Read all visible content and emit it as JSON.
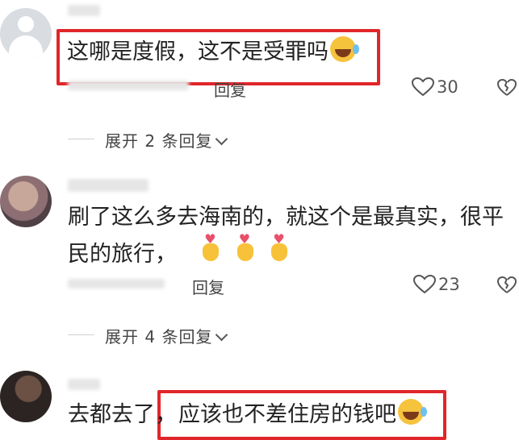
{
  "comments": [
    {
      "text": "这哪是度假，这不是受罪吗",
      "reply_label": "回复",
      "like_count": "30",
      "expand_label": "展开 2 条回复"
    },
    {
      "text_line1": "刷了这么多去海南的，就这个是最真实，很平",
      "text_line2": "民的旅行，",
      "reply_label": "回复",
      "like_count": "23",
      "expand_label": "展开 4 条回复"
    },
    {
      "text_prefix": "去都去了，",
      "text_highlight": "应该也不差住房的钱吧"
    }
  ],
  "colors": {
    "highlight_border": "#e0262a",
    "text": "#222222"
  },
  "icons": [
    "user-avatar-icon",
    "heart-outline-icon",
    "broken-heart-icon",
    "laughing-emoji-icon",
    "heart-hands-emoji-icon",
    "chevron-down-icon"
  ]
}
